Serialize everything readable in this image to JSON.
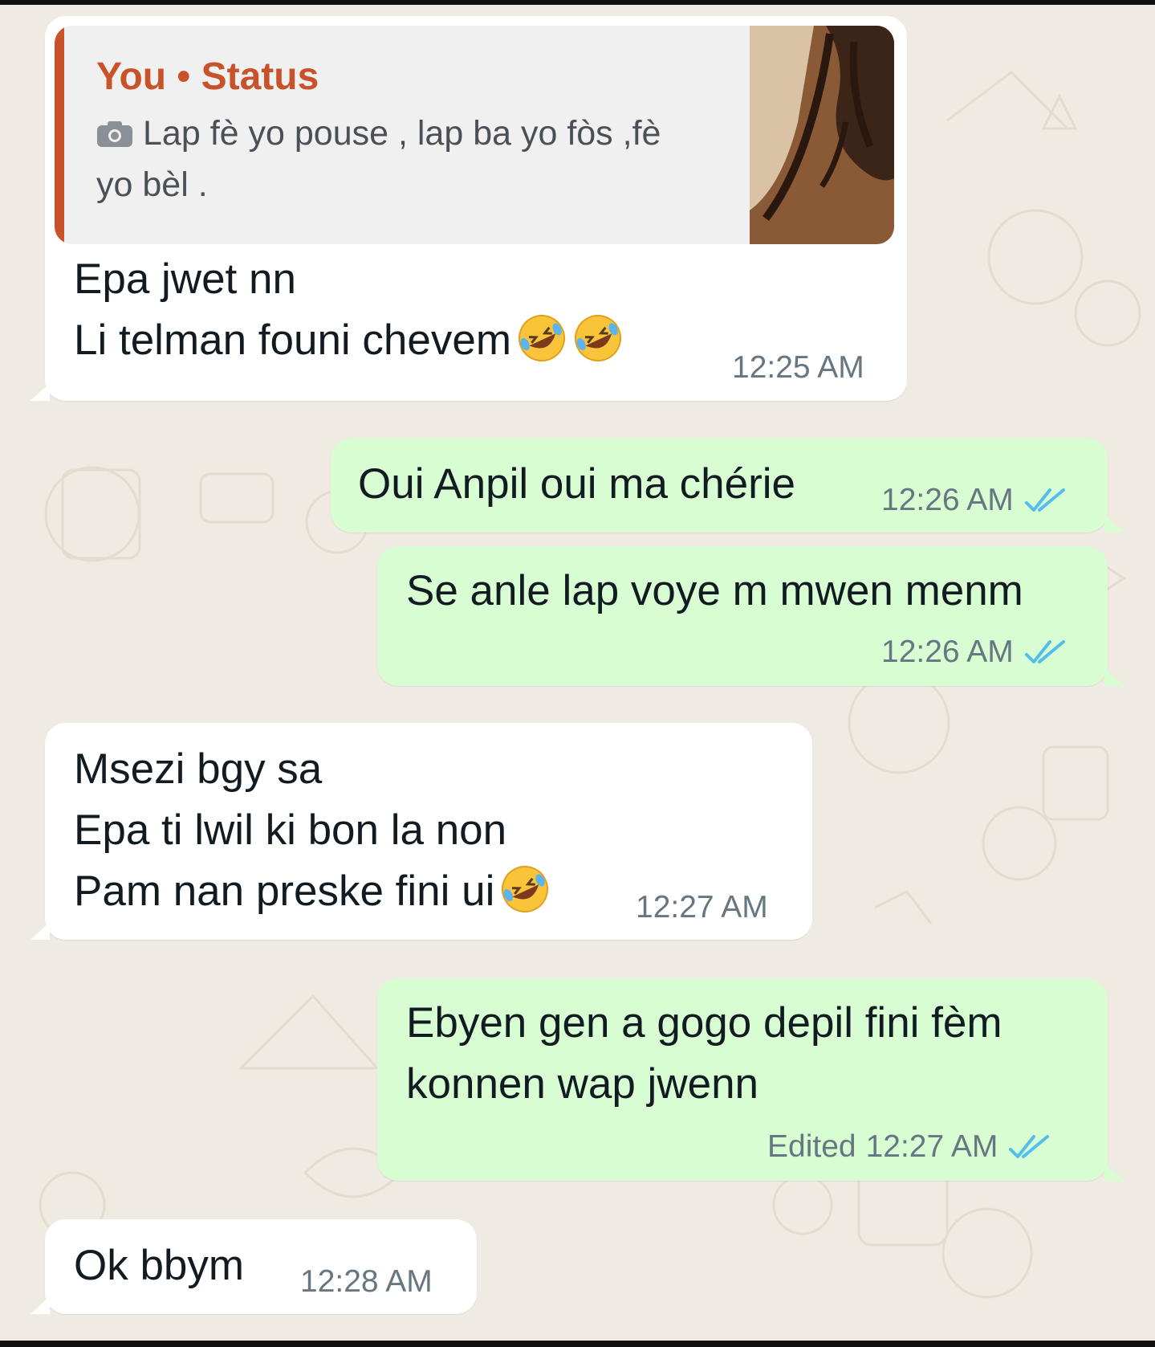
{
  "messages": [
    {
      "quote": {
        "title": "You • Status",
        "text": "Lap fè yo pouse , lap ba yo fòs ,fè yo bèl ."
      },
      "line1": "Epa jwet nn",
      "line2": "Li telman founi chevem",
      "time": "12:25 AM"
    },
    {
      "text": "Oui Anpil oui ma chérie",
      "time": "12:26 AM"
    },
    {
      "text": "Se anle lap voye m mwen menm",
      "time": "12:26 AM"
    },
    {
      "line1": "Msezi bgy sa",
      "line2": "Epa ti lwil ki bon la non",
      "line3": "Pam nan preske fini ui",
      "time": "12:27 AM"
    },
    {
      "line1": "Ebyen gen a gogo depil fini fèm",
      "line2": "konnen wap jwenn",
      "edited": "Edited",
      "time": "12:27 AM"
    },
    {
      "text": "Ok bbym",
      "time": "12:28 AM"
    }
  ],
  "colors": {
    "background": "#efeae2",
    "incoming": "#ffffff",
    "outgoing": "#d9fdd3",
    "quote_accent": "#c8532b",
    "read_ticks": "#53bdeb"
  },
  "icons": [
    "camera-icon",
    "double-check-icon",
    "rofl-emoji"
  ]
}
